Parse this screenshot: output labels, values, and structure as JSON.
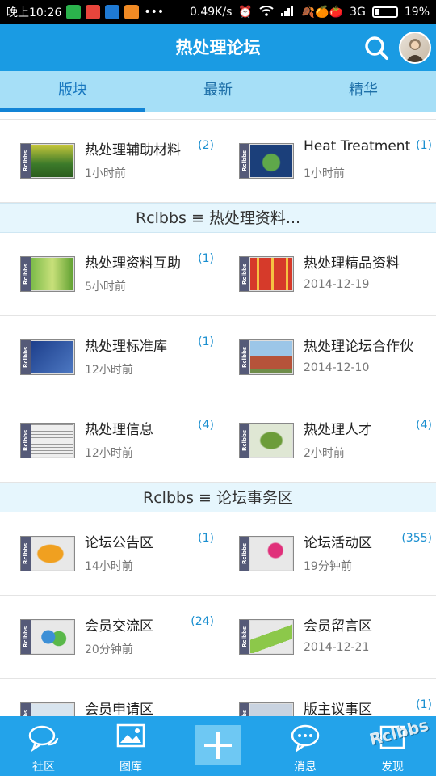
{
  "status": {
    "time": "晚上10:26",
    "speed": "0.49K/s",
    "network": "3G",
    "battery": "19%"
  },
  "appbar": {
    "title": "热处理论坛"
  },
  "tabs": [
    {
      "label": "版块"
    },
    {
      "label": "最新"
    },
    {
      "label": "精华"
    }
  ],
  "sections": [
    {
      "rows": [
        [
          {
            "name": "热处理辅助材料",
            "count": "(2)",
            "time": "1小时前"
          },
          {
            "name": "Heat Treatment",
            "count": "(1)",
            "time": "1小时前"
          }
        ]
      ]
    },
    {
      "header": "Rclbbs ≡ 热处理资料...",
      "rows": [
        [
          {
            "name": "热处理资料互助",
            "count": "(1)",
            "time": "5小时前"
          },
          {
            "name": "热处理精品资料",
            "count": "",
            "time": "2014-12-19"
          }
        ],
        [
          {
            "name": "热处理标准库",
            "count": "(1)",
            "time": "12小时前"
          },
          {
            "name": "热处理论坛合作伙",
            "count": "",
            "time": "2014-12-10"
          }
        ],
        [
          {
            "name": "热处理信息",
            "count": "(4)",
            "time": "12小时前"
          },
          {
            "name": "热处理人才",
            "count": "(4)",
            "time": "2小时前"
          }
        ]
      ]
    },
    {
      "header": "Rclbbs ≡ 论坛事务区",
      "rows": [
        [
          {
            "name": "论坛公告区",
            "count": "(1)",
            "time": "14小时前"
          },
          {
            "name": "论坛活动区",
            "count": "(355)",
            "time": "19分钟前"
          }
        ],
        [
          {
            "name": "会员交流区",
            "count": "(24)",
            "time": "20分钟前"
          },
          {
            "name": "会员留言区",
            "count": "",
            "time": "2014-12-21"
          }
        ],
        [
          {
            "name": "会员申请区",
            "count": "",
            "time": ""
          },
          {
            "name": "版主议事区",
            "count": "(1)",
            "time": ""
          }
        ]
      ]
    }
  ],
  "thumb_brand": "Rclbbs",
  "bottom_nav": [
    {
      "label": "社区",
      "icon": "chat-bubbles-icon"
    },
    {
      "label": "图库",
      "icon": "image-icon"
    },
    {
      "label": "",
      "icon": "plus-icon"
    },
    {
      "label": "消息",
      "icon": "message-icon"
    },
    {
      "label": "发现",
      "icon": "discover-icon"
    }
  ],
  "watermark": "Rclbbs",
  "colors": {
    "primary": "#1a9be3",
    "tab_bg": "#a6dff7",
    "section_bg": "#e6f6fd",
    "count": "#1a8fd0"
  }
}
